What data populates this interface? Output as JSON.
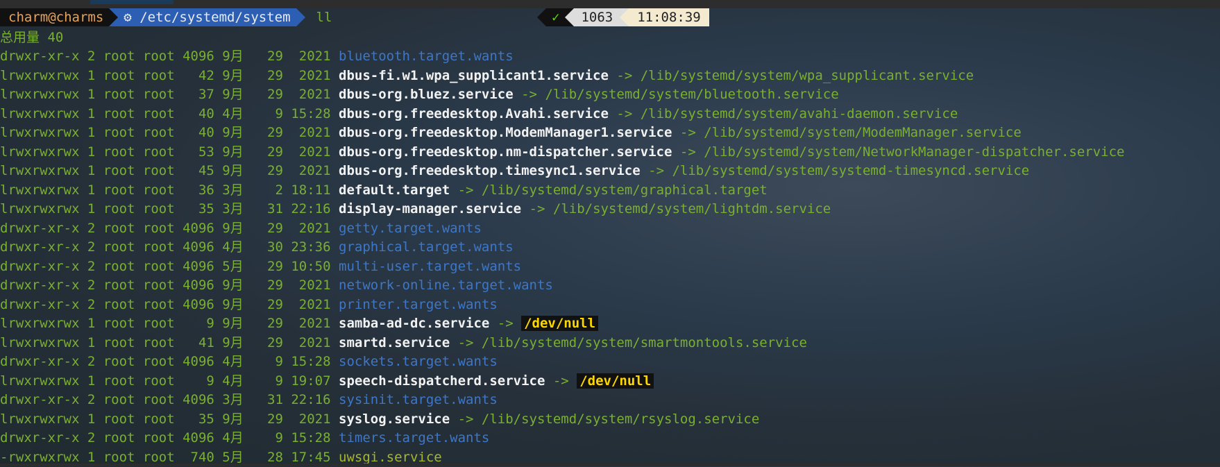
{
  "prompt": {
    "user": "charm@charms",
    "gear_icon": "⚙",
    "path": "/etc/systemd/system",
    "command": "ll",
    "status_ok": "✓",
    "history_num": "1063",
    "time": "11:08:39"
  },
  "total_line": "总用量 40",
  "colors": {
    "meta": "#7ab030",
    "dir": "#3e77c8",
    "link_name": "#f2f2f2",
    "exec": "#a8b82a",
    "null_fg": "#ffd700",
    "null_bg": "#111111"
  },
  "rows": [
    {
      "meta": "drwxr-xr-x 2 root root 4096 9月   29  2021 ",
      "name": "bluetooth.target.wants",
      "kind": "dir",
      "arrow": "",
      "target": ""
    },
    {
      "meta": "lrwxrwxrwx 1 root root   42 9月   29  2021 ",
      "name": "dbus-fi.w1.wpa_supplicant1.service",
      "kind": "link",
      "arrow": " -> ",
      "target": "/lib/systemd/system/wpa_supplicant.service"
    },
    {
      "meta": "lrwxrwxrwx 1 root root   37 9月   29  2021 ",
      "name": "dbus-org.bluez.service",
      "kind": "link",
      "arrow": " -> ",
      "target": "/lib/systemd/system/bluetooth.service"
    },
    {
      "meta": "lrwxrwxrwx 1 root root   40 4月    9 15:28 ",
      "name": "dbus-org.freedesktop.Avahi.service",
      "kind": "link",
      "arrow": " -> ",
      "target": "/lib/systemd/system/avahi-daemon.service"
    },
    {
      "meta": "lrwxrwxrwx 1 root root   40 9月   29  2021 ",
      "name": "dbus-org.freedesktop.ModemManager1.service",
      "kind": "link",
      "arrow": " -> ",
      "target": "/lib/systemd/system/ModemManager.service"
    },
    {
      "meta": "lrwxrwxrwx 1 root root   53 9月   29  2021 ",
      "name": "dbus-org.freedesktop.nm-dispatcher.service",
      "kind": "link",
      "arrow": " -> ",
      "target": "/lib/systemd/system/NetworkManager-dispatcher.service"
    },
    {
      "meta": "lrwxrwxrwx 1 root root   45 9月   29  2021 ",
      "name": "dbus-org.freedesktop.timesync1.service",
      "kind": "link",
      "arrow": " -> ",
      "target": "/lib/systemd/system/systemd-timesyncd.service"
    },
    {
      "meta": "lrwxrwxrwx 1 root root   36 3月    2 18:11 ",
      "name": "default.target",
      "kind": "link",
      "arrow": " -> ",
      "target": "/lib/systemd/system/graphical.target"
    },
    {
      "meta": "lrwxrwxrwx 1 root root   35 3月   31 22:16 ",
      "name": "display-manager.service",
      "kind": "link",
      "arrow": " -> ",
      "target": "/lib/systemd/system/lightdm.service"
    },
    {
      "meta": "drwxr-xr-x 2 root root 4096 9月   29  2021 ",
      "name": "getty.target.wants",
      "kind": "dir",
      "arrow": "",
      "target": ""
    },
    {
      "meta": "drwxr-xr-x 2 root root 4096 4月   30 23:36 ",
      "name": "graphical.target.wants",
      "kind": "dir",
      "arrow": "",
      "target": ""
    },
    {
      "meta": "drwxr-xr-x 2 root root 4096 5月   29 10:50 ",
      "name": "multi-user.target.wants",
      "kind": "dir",
      "arrow": "",
      "target": ""
    },
    {
      "meta": "drwxr-xr-x 2 root root 4096 9月   29  2021 ",
      "name": "network-online.target.wants",
      "kind": "dir",
      "arrow": "",
      "target": ""
    },
    {
      "meta": "drwxr-xr-x 2 root root 4096 9月   29  2021 ",
      "name": "printer.target.wants",
      "kind": "dir",
      "arrow": "",
      "target": ""
    },
    {
      "meta": "lrwxrwxrwx 1 root root    9 9月   29  2021 ",
      "name": "samba-ad-dc.service",
      "kind": "link",
      "arrow": " -> ",
      "target": "/dev/null",
      "null": true
    },
    {
      "meta": "lrwxrwxrwx 1 root root   41 9月   29  2021 ",
      "name": "smartd.service",
      "kind": "link",
      "arrow": " -> ",
      "target": "/lib/systemd/system/smartmontools.service"
    },
    {
      "meta": "drwxr-xr-x 2 root root 4096 4月    9 15:28 ",
      "name": "sockets.target.wants",
      "kind": "dir",
      "arrow": "",
      "target": ""
    },
    {
      "meta": "lrwxrwxrwx 1 root root    9 4月    9 19:07 ",
      "name": "speech-dispatcherd.service",
      "kind": "link",
      "arrow": " -> ",
      "target": "/dev/null",
      "null": true
    },
    {
      "meta": "drwxr-xr-x 2 root root 4096 3月   31 22:16 ",
      "name": "sysinit.target.wants",
      "kind": "dir",
      "arrow": "",
      "target": ""
    },
    {
      "meta": "lrwxrwxrwx 1 root root   35 9月   29  2021 ",
      "name": "syslog.service",
      "kind": "link",
      "arrow": " -> ",
      "target": "/lib/systemd/system/rsyslog.service"
    },
    {
      "meta": "drwxr-xr-x 2 root root 4096 4月    9 15:28 ",
      "name": "timers.target.wants",
      "kind": "dir",
      "arrow": "",
      "target": ""
    },
    {
      "meta": "-rwxrwxrwx 1 root root  740 5月   28 17:45 ",
      "name": "uwsgi.service",
      "kind": "exec",
      "arrow": "",
      "target": ""
    }
  ]
}
